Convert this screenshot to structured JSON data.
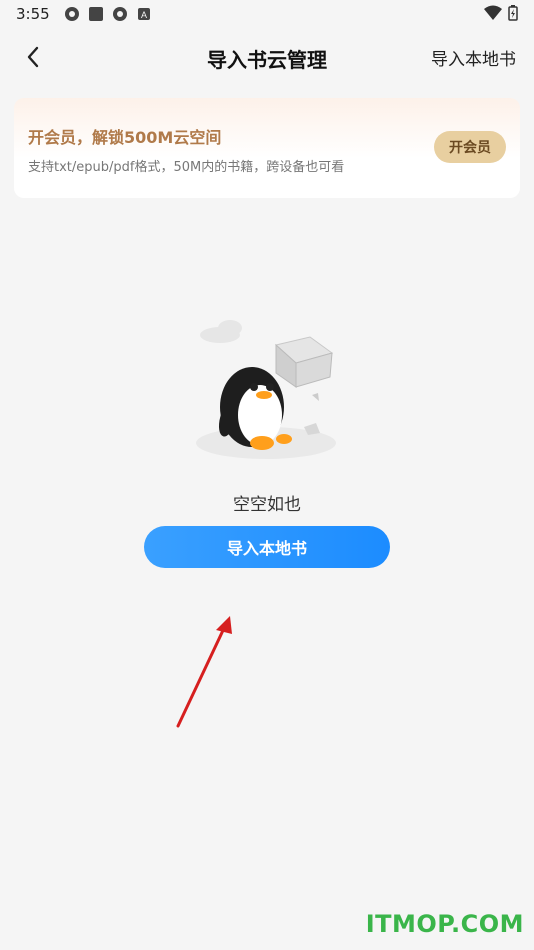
{
  "status_bar": {
    "time": "3:55"
  },
  "header": {
    "back_icon": "chevron-left-icon",
    "title": "导入书云管理",
    "import_local": "导入本地书"
  },
  "vip_banner": {
    "title": "开会员，解锁500M云空间",
    "subtitle": "支持txt/epub/pdf格式，50M内的书籍，跨设备也可看",
    "button": "开会员",
    "title_color": "#b07a4a",
    "button_color": "#e8cfa0"
  },
  "empty_state": {
    "illustration": "penguin-with-box-illustration",
    "text": "空空如也",
    "button": "导入本地书",
    "button_color": "#1c8cff"
  },
  "watermark": {
    "text": "ITMOP.COM",
    "color": "#3ab54a"
  }
}
